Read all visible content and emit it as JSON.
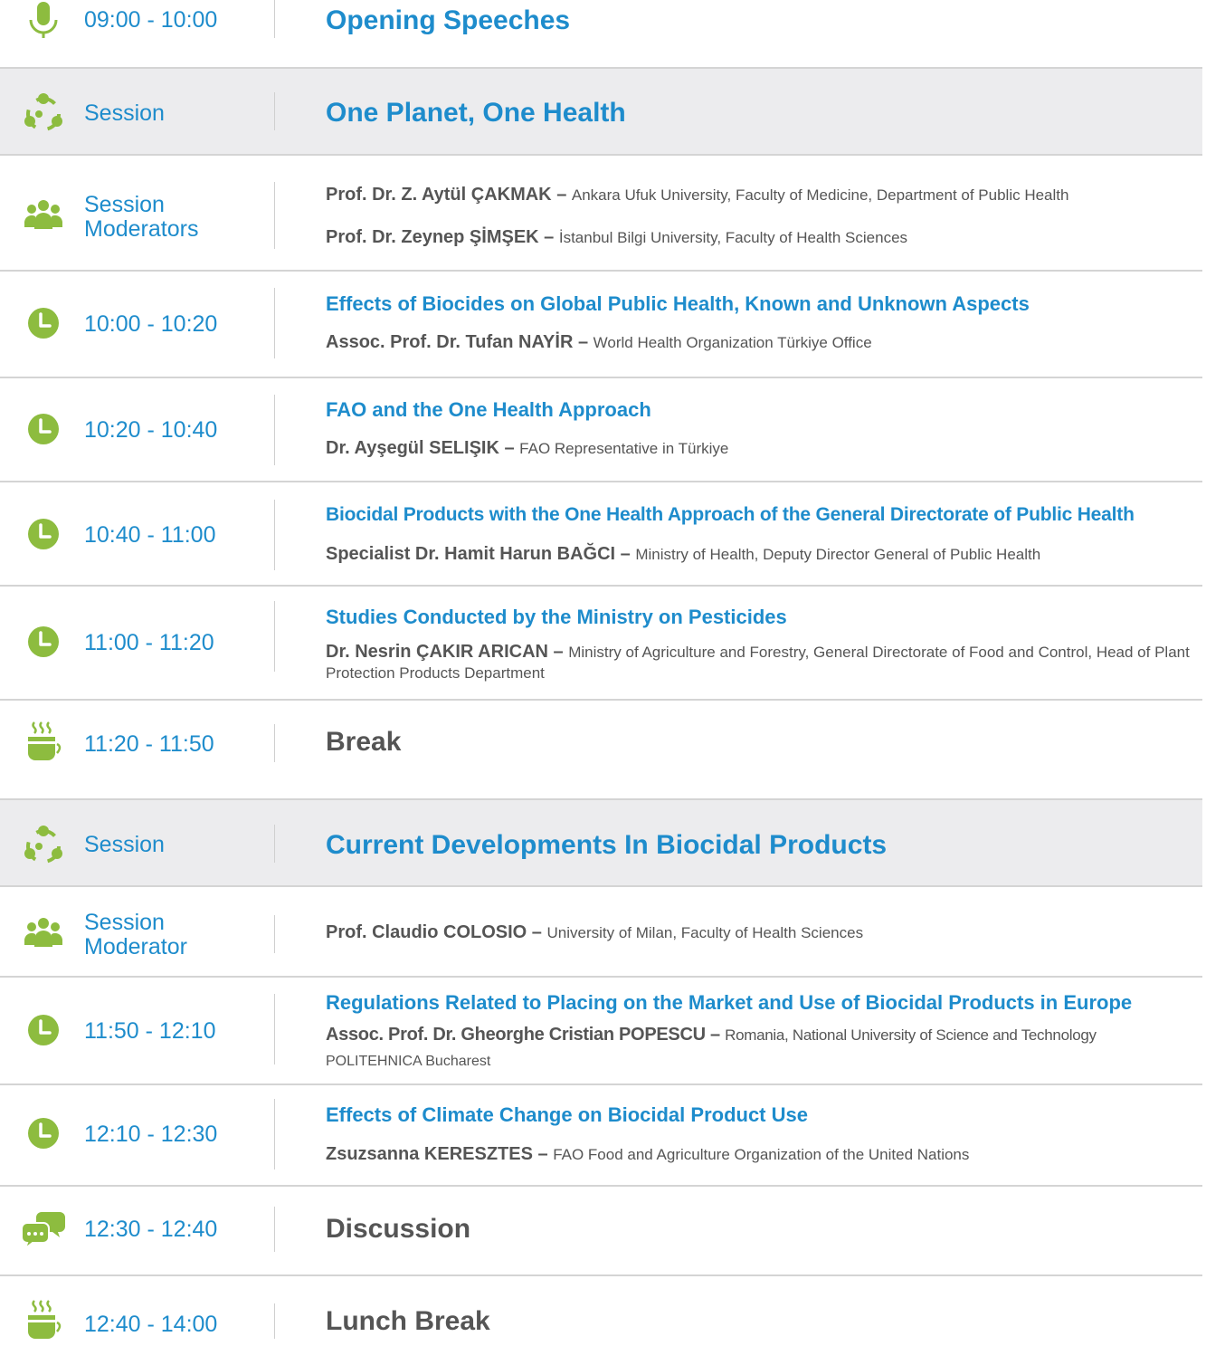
{
  "colors": {
    "accent_blue": "#1e8ccc",
    "icon_green": "#8dbc3f",
    "shade": "#ececee",
    "text_gray": "#555555"
  },
  "rows": {
    "opening": {
      "icon": "microphone-icon",
      "time": "09:00 - 10:00",
      "title": "Opening Speeches"
    },
    "session1": {
      "icon": "network-icon",
      "label": "Session",
      "title": "One Planet, One Health"
    },
    "moderators1": {
      "icon": "people-icon",
      "label_line1": "Session",
      "label_line2": "Moderators",
      "people": [
        {
          "name": "Prof. Dr. Z. Aytül ÇAKMAK",
          "dash": "–",
          "affiliation": "Ankara Ufuk University, Faculty of Medicine, Department of Public Health"
        },
        {
          "name": "Prof. Dr. Zeynep ŞİMŞEK",
          "dash": "–",
          "affiliation": "İstanbul Bilgi University, Faculty of Health Sciences"
        }
      ]
    },
    "talks1": [
      {
        "icon": "clock-icon",
        "time": "10:00 - 10:20",
        "title": "Effects of Biocides on Global Public Health, Known and Unknown Aspects",
        "speaker": "Assoc. Prof. Dr. Tufan NAYİR",
        "dash": "–",
        "affiliation": "World Health Organization Türkiye Office"
      },
      {
        "icon": "clock-icon",
        "time": "10:20 - 10:40",
        "title": "FAO and the One Health Approach",
        "speaker": "Dr. Ayşegül SELIŞIK",
        "dash": "–",
        "affiliation": "FAO Representative in Türkiye"
      },
      {
        "icon": "clock-icon",
        "time": "10:40 - 11:00",
        "title": "Biocidal Products with the One Health Approach of the General Directorate of Public Health",
        "speaker": "Specialist Dr. Hamit Harun BAĞCI",
        "dash": "–",
        "affiliation": "Ministry of Health, Deputy Director General of Public Health"
      },
      {
        "icon": "clock-icon",
        "time": "11:00 - 11:20",
        "title": "Studies Conducted by the Ministry on Pesticides",
        "speaker": "Dr. Nesrin ÇAKIR ARICAN",
        "dash": "–",
        "affiliation": "Ministry of Agriculture and Forestry, General Directorate of Food and Control, Head of Plant Protection Products Department"
      }
    ],
    "break1": {
      "icon": "coffee-cup-icon",
      "time": "11:20 - 11:50",
      "title": "Break"
    },
    "session2": {
      "icon": "network-icon",
      "label": "Session",
      "title": "Current Developments In Biocidal Products"
    },
    "moderator2": {
      "icon": "people-icon",
      "label_line1": "Session",
      "label_line2": "Moderator",
      "name": "Prof. Claudio COLOSIO",
      "dash": "–",
      "affiliation": "University of Milan, Faculty of Health Sciences"
    },
    "talks2": [
      {
        "icon": "clock-icon",
        "time": "11:50 - 12:10",
        "title": "Regulations Related to Placing on the Market and Use of Biocidal Products in Europe",
        "speaker": "Assoc. Prof. Dr. Gheorghe Cristian POPESCU",
        "dash": "–",
        "affiliation": "Romania, National University of Science and Technology",
        "affiliation_line2": "POLITEHNICA Bucharest"
      },
      {
        "icon": "clock-icon",
        "time": "12:10 - 12:30",
        "title": "Effects of Climate Change on Biocidal Product Use",
        "speaker": "Zsuzsanna KERESZTES",
        "dash": "–",
        "affiliation": "FAO Food and Agriculture Organization of the United Nations"
      }
    ],
    "discussion": {
      "icon": "chat-bubbles-icon",
      "time": "12:30 - 12:40",
      "title": "Discussion"
    },
    "lunch": {
      "icon": "coffee-cup-icon",
      "time": "12:40 - 14:00",
      "title": "Lunch Break"
    }
  }
}
